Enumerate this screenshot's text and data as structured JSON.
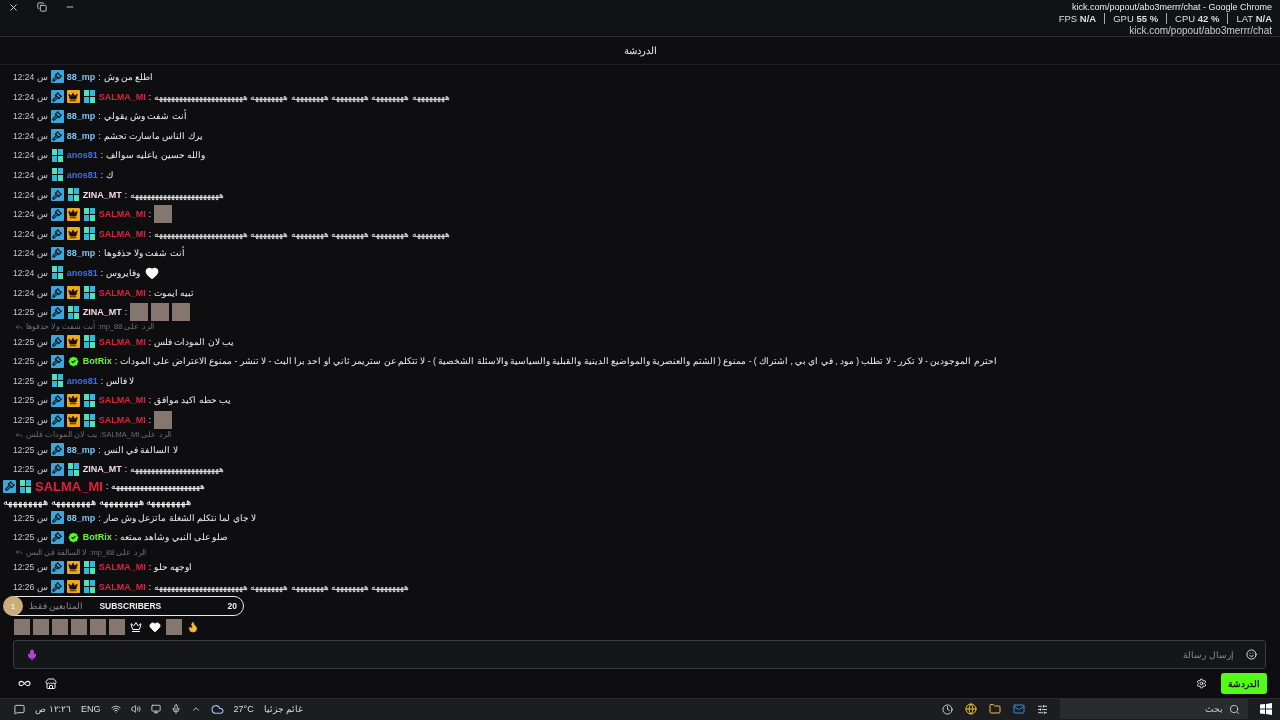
{
  "window": {
    "title": "kick.com/popout/abo3merrr/chat - Google Chrome",
    "url": "kick.com/popout/abo3merrr/chat"
  },
  "stats": [
    "LAT **N/A**",
    "CPU **42 %**",
    "GPU **55 %**",
    "FPS **N/A**"
  ],
  "header": {
    "title": "الدردشة"
  },
  "chat": {
    "separator": ":",
    "messages": [
      {
        "time": "12:24 س",
        "badges": [
          {
            "kind": "mod"
          }
        ],
        "name": "88_mp",
        "color": "#7cc6f2",
        "text": "اطلع من وش"
      },
      {
        "time": "12:24 س",
        "badges": [
          {
            "kind": "mod"
          },
          {
            "kind": "vip"
          },
          {
            "kind": "og"
          }
        ],
        "name": "SALMA_MI",
        "color": "#e0213e",
        "text": "ههههههههه ههههههههه ههههههههه ههههههههه ههههههههه ههههههههههههههههههههههه"
      },
      {
        "time": "12:24 س",
        "badges": [
          {
            "kind": "mod"
          }
        ],
        "name": "88_mp",
        "color": "#7cc6f2",
        "text": "أنت شفت وش يقولي"
      },
      {
        "time": "12:24 س",
        "badges": [
          {
            "kind": "mod"
          }
        ],
        "name": "88_mp",
        "color": "#7cc6f2",
        "text": "يرك الناس ماسارت تحشم"
      },
      {
        "time": "12:24 س",
        "badges": [
          {
            "kind": "og"
          }
        ],
        "name": "anos81",
        "color": "#3d6fe6",
        "text": "والله حسين ياعليه سوالف"
      },
      {
        "time": "12:24 س",
        "badges": [
          {
            "kind": "og"
          }
        ],
        "name": "anos81",
        "color": "#3d6fe6",
        "text": "ك"
      },
      {
        "time": "12:24 س",
        "badges": [
          {
            "kind": "mod"
          },
          {
            "kind": "og"
          }
        ],
        "name": "ZINA_MT",
        "color": "#f6d9e6",
        "text": "ههههههههههههههههههههههه"
      },
      {
        "time": "12:24 س",
        "badges": [
          {
            "kind": "mod"
          },
          {
            "kind": "vip"
          },
          {
            "kind": "og"
          }
        ],
        "name": "SALMA_MI",
        "color": "#e0213e",
        "emotes": [
          {
            "kind": "photo"
          }
        ]
      },
      {
        "time": "12:24 س",
        "badges": [
          {
            "kind": "mod"
          },
          {
            "kind": "vip"
          },
          {
            "kind": "og"
          }
        ],
        "name": "SALMA_MI",
        "color": "#e0213e",
        "text": "ههههههههه ههههههههه ههههههههه ههههههههه ههههههههه ههههههههههههههههههههههه"
      },
      {
        "time": "12:24 س",
        "badges": [
          {
            "kind": "mod"
          }
        ],
        "name": "88_mp",
        "color": "#7cc6f2",
        "text": "أنت شفت ولا حذفوها"
      },
      {
        "time": "12:24 س",
        "badges": [
          {
            "kind": "og"
          }
        ],
        "name": "anos81",
        "color": "#3d6fe6",
        "text": "وفايروس",
        "emotes": [
          {
            "kind": "heart"
          }
        ]
      },
      {
        "time": "12:24 س",
        "badges": [
          {
            "kind": "mod"
          },
          {
            "kind": "vip"
          },
          {
            "kind": "og"
          }
        ],
        "name": "SALMA_MI",
        "color": "#e0213e",
        "text": "تبيه ايموت"
      },
      {
        "time": "12:25 س",
        "badges": [
          {
            "kind": "mod"
          },
          {
            "kind": "og"
          }
        ],
        "name": "ZINA_MT",
        "color": "#f6d9e6",
        "emotes": [
          {
            "kind": "photo"
          },
          {
            "kind": "photo"
          },
          {
            "kind": "photo"
          }
        ]
      },
      {
        "time": "12:25 س",
        "reply": "الرد على 88_mp: أنت شفت ولا حذفوها",
        "badges": [
          {
            "kind": "mod"
          },
          {
            "kind": "vip"
          },
          {
            "kind": "og"
          }
        ],
        "name": "SALMA_MI",
        "color": "#e0213e",
        "text": "يب لان المودات فلس"
      },
      {
        "time": "12:25 س",
        "badges": [
          {
            "kind": "mod"
          },
          {
            "kind": "bot"
          }
        ],
        "name": "BotRix",
        "color": "#6cf23c",
        "text": "احترم الموجودين - لا تكرر - لا تطلب ( مود , في اي بي , اشتراك ) - ممنوع ( الشتم والعنصرية والمواضيع الدينية والقبلية والسياسية والاسئلة الشخصية ) - لا تتكلم عن ستريمر ثاني او احد برا البث - لا تنشر - ممنوع الاعتراض على المودات"
      },
      {
        "time": "12:25 س",
        "badges": [
          {
            "kind": "og"
          }
        ],
        "name": "anos81",
        "color": "#3d6fe6",
        "text": "لا فالس"
      },
      {
        "time": "12:25 س",
        "badges": [
          {
            "kind": "mod"
          },
          {
            "kind": "vip"
          },
          {
            "kind": "og"
          }
        ],
        "name": "SALMA_MI",
        "color": "#e0213e",
        "text": "يب حطه اكيد موافق"
      },
      {
        "time": "12:25 س",
        "badges": [
          {
            "kind": "mod"
          },
          {
            "kind": "vip"
          },
          {
            "kind": "og"
          }
        ],
        "name": "SALMA_MI",
        "color": "#e0213e",
        "emotes": [
          {
            "kind": "photo"
          }
        ]
      },
      {
        "time": "12:25 س",
        "reply": "الرد على SALMA_Mt: يب لان المودات فلس",
        "badges": [
          {
            "kind": "mod"
          }
        ],
        "name": "88_mp",
        "color": "#7cc6f2",
        "text": "لا السالفة في النس"
      },
      {
        "time": "12:25 س",
        "badges": [
          {
            "kind": "mod"
          },
          {
            "kind": "og"
          }
        ],
        "name": "ZINA_MT",
        "color": "#f6d9e6",
        "text": "ههههههههههههههههههههههه"
      },
      {
        "time": "12:25 س",
        "badges": [
          {
            "kind": "mod"
          }
        ],
        "name": "88_mp",
        "color": "#7cc6f2",
        "text": "لا جاي لما نتكلم الشغلة ماتزعل وش صار"
      },
      {
        "time": "12:25 س",
        "badges": [
          {
            "kind": "mod"
          },
          {
            "kind": "bot"
          }
        ],
        "name": "BotRix",
        "color": "#6cf23c",
        "text": "صلو على النبي وشاهد ممتعه"
      },
      {
        "time": "12:25 س",
        "reply": "الرد على 88_mp: لا السالفة في النس",
        "badges": [
          {
            "kind": "mod"
          },
          {
            "kind": "vip"
          },
          {
            "kind": "og"
          }
        ],
        "name": "SALMA_MI",
        "color": "#e0213e",
        "text": "اوجهه حلو"
      },
      {
        "time": "12:26 س",
        "badges": [
          {
            "kind": "mod"
          },
          {
            "kind": "vip"
          },
          {
            "kind": "og"
          }
        ],
        "name": "SALMA_MI",
        "color": "#e0213e",
        "text": "ههههههههه ههههههههه ههههههههه ههههههههه ههههههههههههههههههههههه"
      }
    ]
  },
  "overlay": {
    "badges": [
      {
        "kind": "mod"
      },
      {
        "kind": "og"
      }
    ],
    "name": "SALMA_MI",
    "color": "#e0213e",
    "separator": ":",
    "line_1": "ههههههههههههههههههههههه",
    "line_2": "ههههههههه ههههههههه ههههههههه ههههههههه"
  },
  "subscribers": {
    "rank": "1",
    "mode": "المتابعين فقط",
    "label": "SUBSCRIBERS",
    "count": "20"
  },
  "emotes": [
    {
      "kind": "photo"
    },
    {
      "kind": "photo"
    },
    {
      "kind": "photo"
    },
    {
      "kind": "photo"
    },
    {
      "kind": "photo"
    },
    {
      "kind": "photo"
    },
    {
      "kind": "crown"
    },
    {
      "kind": "heart"
    },
    {
      "kind": "photo"
    },
    {
      "kind": "fire"
    }
  ],
  "composer": {
    "placeholder": "إرسال رسالة"
  },
  "chat_button": {
    "label": "الدردشة"
  },
  "taskbar": {
    "time": "١٢:٢٦ ص",
    "language": "ENG",
    "temperature": "27°C",
    "weather": "غائم جزئيا",
    "search_placeholder": "بحث"
  }
}
